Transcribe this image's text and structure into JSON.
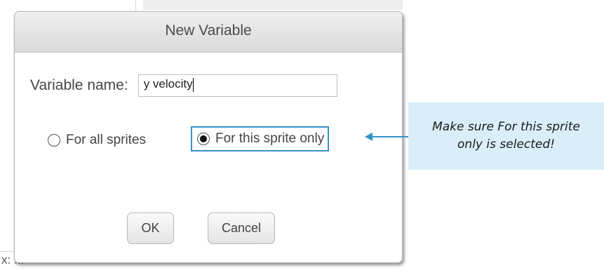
{
  "dialog": {
    "title": "New Variable",
    "name_label": "Variable name:",
    "name_value": "y velocity",
    "options": [
      {
        "label": "For all sprites",
        "selected": false
      },
      {
        "label": "For this sprite only",
        "selected": true
      }
    ],
    "ok_label": "OK",
    "cancel_label": "Cancel"
  },
  "background": {
    "bottom_text": "x: ..."
  },
  "callout": {
    "text": "Make sure For this sprite only is selected!",
    "highlight_color": "#3591c7",
    "background_color": "#d9eef9"
  }
}
